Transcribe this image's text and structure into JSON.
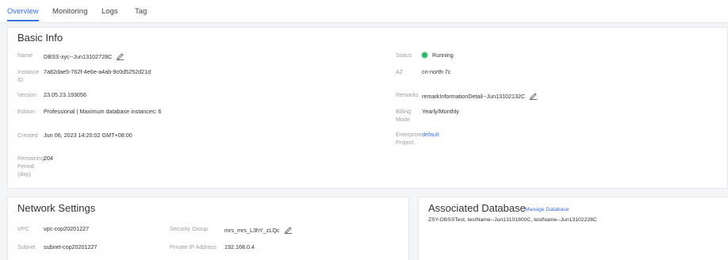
{
  "tabs": [
    "Overview",
    "Monitoring",
    "Logs",
    "Tag"
  ],
  "basic_info": {
    "title": "Basic Info",
    "name_label": "Name",
    "name_value": "DBSS-xyc--Jun13102728C",
    "instance_id_label_1": "Instance",
    "instance_id_label_2": "ID",
    "instance_id_value": "7a82dae5-762f-4e6e-a4ab-9c0d5252d21d",
    "version_label": "Version",
    "version_value": "23.05.23.193056",
    "edition_label": "Edition",
    "edition_value": "Professional | Maximum database instances: 6",
    "created_label": "Created",
    "created_value": "Jun 06, 2023 14:20:02 GMT+08:00",
    "remaining_label_1": "Remaining",
    "remaining_label_2": "Period",
    "remaining_label_3": "(day)",
    "remaining_value": "204",
    "status_label": "Status",
    "status_value": "Running",
    "az_label": "AZ",
    "az_value": "cn-north-7c",
    "remarks_label": "Remarks",
    "remarks_value": "remarkInformationDetail--Jun13102132C",
    "billing_label_1": "Billing",
    "billing_label_2": "Mode",
    "billing_value": "Yearly/Monthly",
    "project_label_1": "Enterprise",
    "project_label_2": "Project",
    "project_value": "default"
  },
  "network": {
    "title": "Network Settings",
    "vpc_label": "VPC",
    "vpc_value": "vpc-cop20201227",
    "subnet_label": "Subnet",
    "subnet_value": "subnet-cop20201227",
    "sg_label": "Security Group",
    "sg_value": "mrs_mrs_L3hY_zLQc",
    "ip_label": "Private IP Address",
    "ip_value": "192.168.0.4"
  },
  "associated": {
    "title": "Associated Database",
    "manage_link": "Manage Database",
    "list": "ZSY-DBSSTest, testName--Jun13101800C, testName--Jun13102228C"
  },
  "colors": {
    "accent": "#3a6fdc",
    "status_running": "#35b36b",
    "label_gray": "#9b9ea4",
    "page_bg": "#f4f5f7"
  }
}
